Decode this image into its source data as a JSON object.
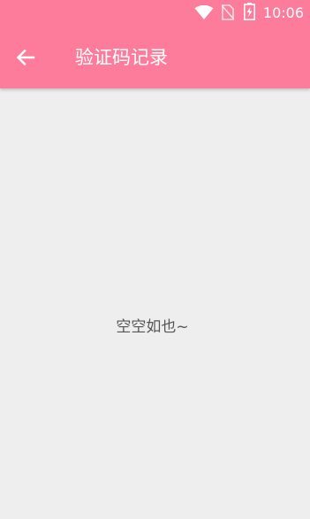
{
  "status_bar": {
    "time": "10:06",
    "icons": [
      "wifi-icon",
      "no-sim-icon",
      "battery-charging-icon"
    ]
  },
  "header": {
    "back_icon": "arrow-left-icon",
    "title": "验证码记录"
  },
  "main": {
    "empty_text": "空空如也~"
  },
  "colors": {
    "header_bg": "#fe7c9b",
    "page_bg": "#eeeeee",
    "header_text": "#ffffff",
    "empty_text": "#555555"
  }
}
